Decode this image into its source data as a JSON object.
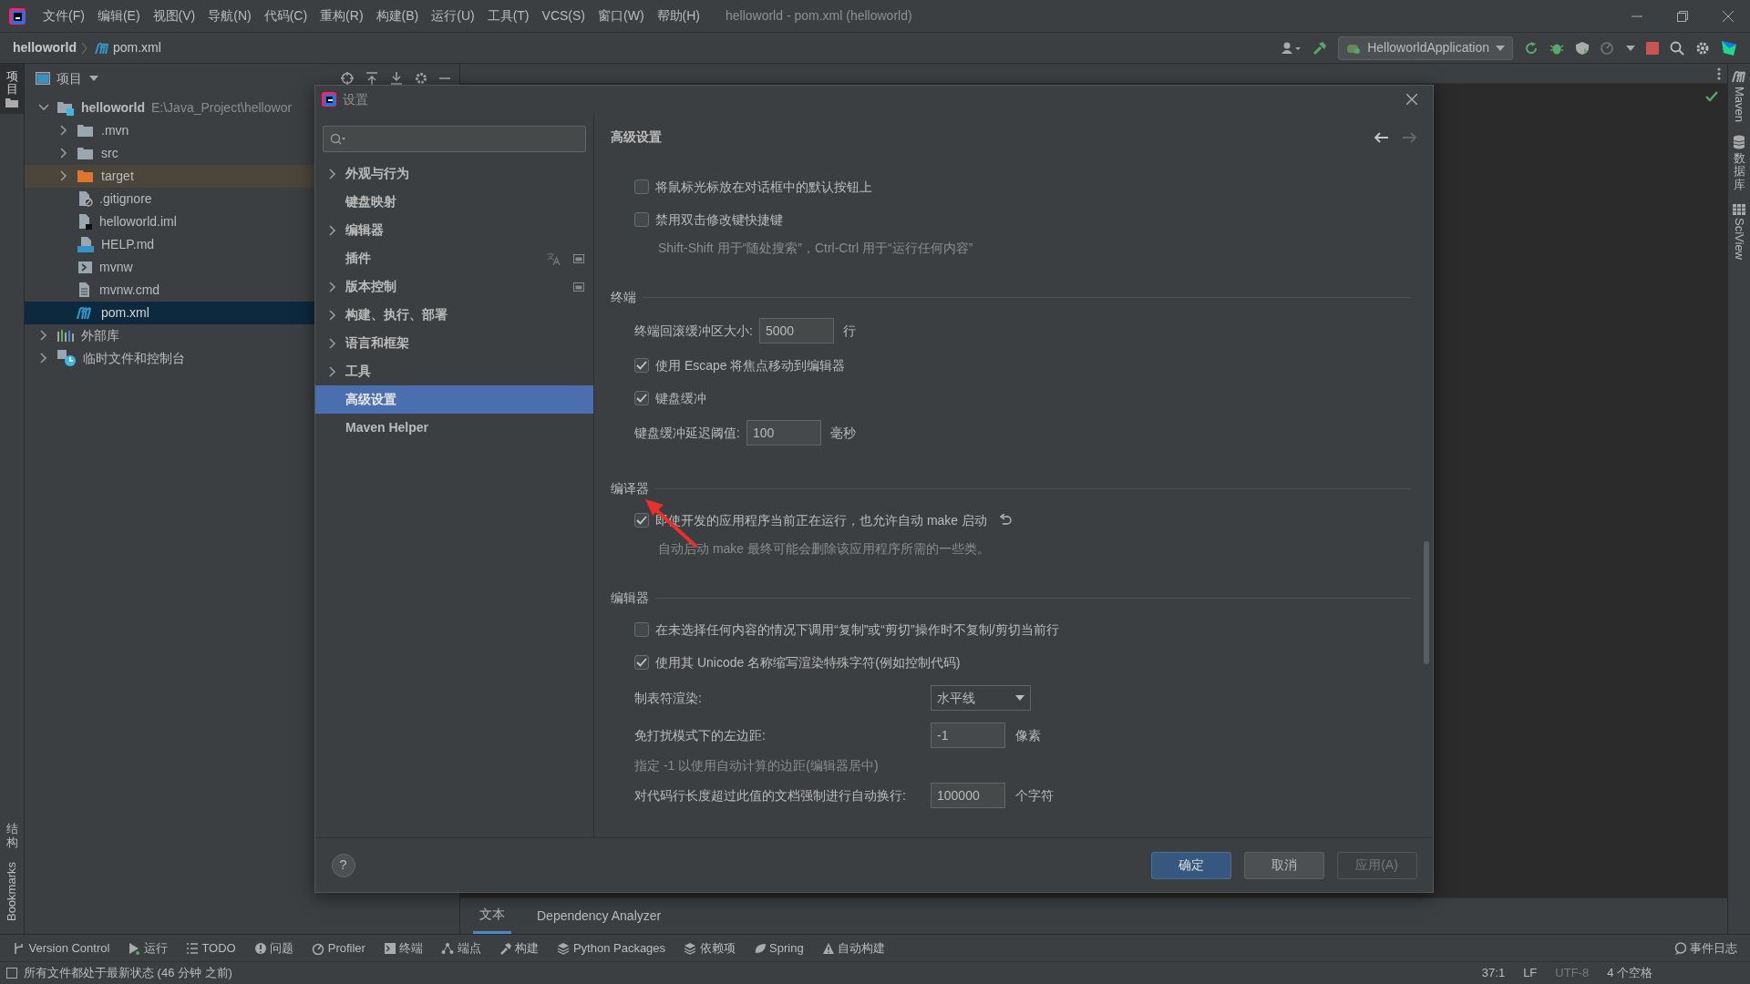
{
  "window": {
    "title": "helloworld - pom.xml (helloworld)"
  },
  "menu": [
    "文件(F)",
    "编辑(E)",
    "视图(V)",
    "导航(N)",
    "代码(C)",
    "重构(R)",
    "构建(B)",
    "运行(U)",
    "工具(T)",
    "VCS(S)",
    "窗口(W)",
    "帮助(H)"
  ],
  "breadcrumb": [
    "helloworld",
    "pom.xml"
  ],
  "run_config": "HelloworldApplication",
  "left_strip": [
    {
      "label": "项目",
      "kind": "stacked",
      "selected": true
    },
    {
      "label": "结构",
      "kind": "stacked",
      "selected": false
    },
    {
      "label": "Bookmarks",
      "kind": "rotated",
      "selected": false
    }
  ],
  "right_strip": [
    {
      "label": "Maven",
      "kind": "rotated"
    },
    {
      "label": "数据库",
      "kind": "stacked"
    },
    {
      "label": "SciView",
      "kind": "rotated"
    }
  ],
  "project_panel": {
    "title": "项目",
    "tree": [
      {
        "name": "helloworld",
        "path": "E:\\Java_Project\\hellowor",
        "kind": "module",
        "expanded": true,
        "selected": false,
        "children": [
          {
            "name": ".mvn",
            "kind": "folder",
            "expanded": false,
            "selected": false
          },
          {
            "name": "src",
            "kind": "folder",
            "expanded": false,
            "selected": false
          },
          {
            "name": "target",
            "kind": "excluded",
            "expanded": false,
            "selected": false
          },
          {
            "name": ".gitignore",
            "kind": "ignore",
            "selected": false
          },
          {
            "name": "helloworld.iml",
            "kind": "iml",
            "selected": false
          },
          {
            "name": "HELP.md",
            "kind": "md",
            "selected": false
          },
          {
            "name": "mvnw",
            "kind": "shell",
            "selected": false
          },
          {
            "name": "mvnw.cmd",
            "kind": "text",
            "selected": false
          },
          {
            "name": "pom.xml",
            "kind": "maven",
            "selected": true
          }
        ]
      },
      {
        "name": "外部库",
        "kind": "library",
        "expanded": false,
        "selected": false
      },
      {
        "name": "临时文件和控制台",
        "kind": "scratch",
        "expanded": false,
        "selected": false
      }
    ]
  },
  "editor": {
    "bottom_tabs": [
      {
        "label": "文本",
        "selected": true
      },
      {
        "label": "Dependency Analyzer",
        "selected": false
      }
    ]
  },
  "dialog": {
    "title": "设置",
    "nav": [
      {
        "label": "外观与行为",
        "expandable": true,
        "selected": false,
        "translate_badge": false,
        "project_badge": false
      },
      {
        "label": "键盘映射",
        "expandable": false,
        "selected": false,
        "translate_badge": false,
        "project_badge": false
      },
      {
        "label": "编辑器",
        "expandable": true,
        "selected": false,
        "translate_badge": false,
        "project_badge": false
      },
      {
        "label": "插件",
        "expandable": false,
        "selected": false,
        "translate_badge": true,
        "project_badge": true
      },
      {
        "label": "版本控制",
        "expandable": true,
        "selected": false,
        "translate_badge": false,
        "project_badge": true
      },
      {
        "label": "构建、执行、部署",
        "expandable": true,
        "selected": false,
        "translate_badge": false,
        "project_badge": false
      },
      {
        "label": "语言和框架",
        "expandable": true,
        "selected": false,
        "translate_badge": false,
        "project_badge": false
      },
      {
        "label": "工具",
        "expandable": true,
        "selected": false,
        "translate_badge": false,
        "project_badge": false
      },
      {
        "label": "高级设置",
        "expandable": false,
        "selected": true,
        "translate_badge": false,
        "project_badge": false
      },
      {
        "label": "Maven Helper",
        "expandable": false,
        "selected": false,
        "translate_badge": false,
        "project_badge": false
      }
    ],
    "page_title": "高级设置",
    "rows": [
      {
        "kind": "checkbox",
        "label": "将鼠标光标放在对话框中的默认按钮上",
        "checked": false,
        "modified": false
      },
      {
        "kind": "checkbox",
        "label": "禁用双击修改键快捷键",
        "checked": false,
        "modified": false
      },
      {
        "kind": "hint",
        "text": "Shift-Shift 用于“随处搜索”，Ctrl-Ctrl 用于“运行任何内容”"
      },
      {
        "kind": "section",
        "text": "终端"
      },
      {
        "kind": "field",
        "label": "终端回滚缓冲区大小:",
        "value": "5000",
        "unit": "行"
      },
      {
        "kind": "checkbox",
        "label": "使用 Escape 将焦点移动到编辑器",
        "checked": true,
        "modified": false
      },
      {
        "kind": "checkbox",
        "label": "键盘缓冲",
        "checked": true,
        "modified": false
      },
      {
        "kind": "field",
        "label": "键盘缓冲延迟阈值:",
        "value": "100",
        "unit": "毫秒"
      },
      {
        "kind": "section",
        "text": "编译器"
      },
      {
        "kind": "checkbox",
        "label": "即使开发的应用程序当前正在运行，也允许自动 make 启动",
        "checked": true,
        "modified": true
      },
      {
        "kind": "hint",
        "text": "自动启动 make 最终可能会删除该应用程序所需的一些类。"
      },
      {
        "kind": "section",
        "text": "编辑器"
      },
      {
        "kind": "checkbox",
        "label": "在未选择任何内容的情况下调用“复制”或“剪切”操作时不复制/剪切当前行",
        "checked": false,
        "modified": false
      },
      {
        "kind": "checkbox",
        "label": "使用其 Unicode 名称缩写渲染特殊字符(例如控制代码)",
        "checked": true,
        "modified": false
      },
      {
        "kind": "dropdown",
        "label": "制表符渲染:",
        "value": "水平线"
      },
      {
        "kind": "field",
        "label": "免打扰模式下的左边距:",
        "value": "-1",
        "unit": "像素",
        "wide": true
      },
      {
        "kind": "hint",
        "text": "指定 -1 以使用自动计算的边距(编辑器居中)"
      },
      {
        "kind": "field",
        "label": "对代码行长度超过此值的文档强制进行自动换行:",
        "value": "100000",
        "unit": "个字符",
        "wide": true
      }
    ],
    "help": "?",
    "buttons": [
      {
        "label": "确定",
        "kind": "primary",
        "disabled": false
      },
      {
        "label": "取消",
        "kind": "normal",
        "disabled": false
      },
      {
        "label": "应用(A)",
        "kind": "normal",
        "disabled": true
      }
    ]
  },
  "tool_windows": [
    "Version Control",
    "运行",
    "TODO",
    "问题",
    "Profiler",
    "终端",
    "端点",
    "构建",
    "Python Packages",
    "依赖项",
    "Spring",
    "自动构建"
  ],
  "event_log": "事件日志",
  "status_bar": {
    "message": "所有文件都处于最新状态 (46 分钟 之前)",
    "items": [
      {
        "text": "37:1",
        "dim": false
      },
      {
        "text": "LF",
        "dim": false
      },
      {
        "text": "UTF-8",
        "dim": true
      },
      {
        "text": "4 个空格",
        "dim": false
      }
    ]
  }
}
